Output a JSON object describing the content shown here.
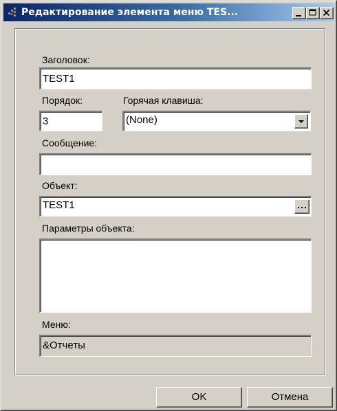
{
  "window": {
    "title": "Редактирование элемента меню TES...",
    "app_icon": "menu-edit-icon"
  },
  "colors": {
    "titlebar_start": "#0a246a",
    "titlebar_end": "#a6caf0",
    "face": "#d4d0c8"
  },
  "form": {
    "caption_label": "Заголовок:",
    "caption_value": "TEST1",
    "order_label": "Порядок:",
    "order_value": "3",
    "hotkey_label": "Горячая клавиша:",
    "hotkey_value": "(None)",
    "message_label": "Сообщение:",
    "message_value": "",
    "object_label": "Объект:",
    "object_value": "TEST1",
    "object_browse_label": "...",
    "params_label": "Параметры объекта:",
    "params_value": "",
    "menu_label": "Меню:",
    "menu_value": "&Отчеты"
  },
  "buttons": {
    "ok_label": "OK",
    "cancel_label": "Отмена"
  }
}
